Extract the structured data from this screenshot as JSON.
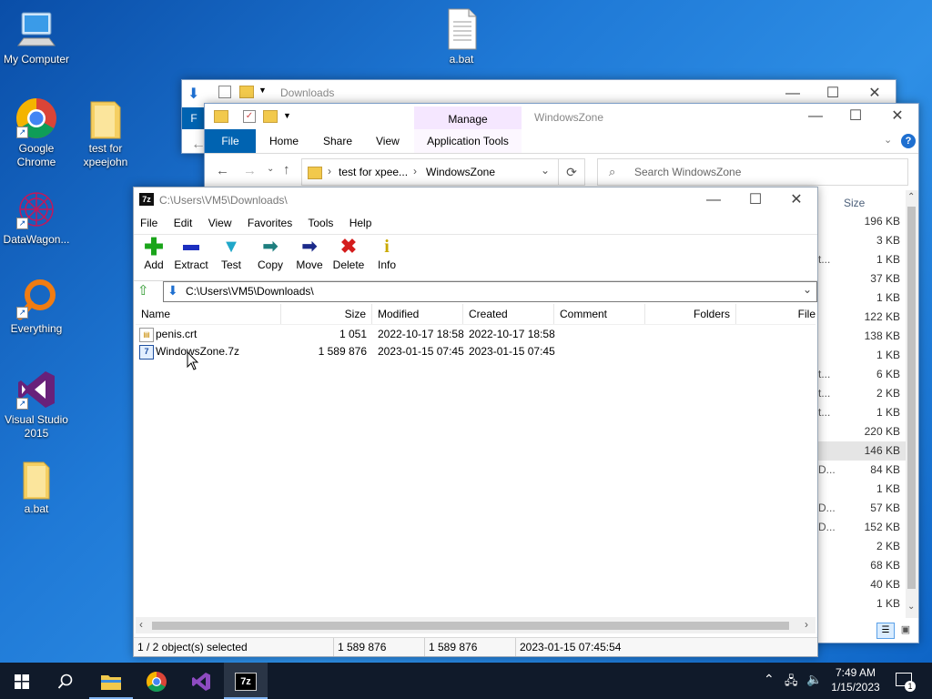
{
  "desktop": {
    "icons": [
      {
        "label": "My Computer"
      },
      {
        "label": "a.bat"
      },
      {
        "label": "Google Chrome"
      },
      {
        "label": "test for xpeejohn"
      },
      {
        "label": "DataWagon..."
      },
      {
        "label": "Everything"
      },
      {
        "label": "Visual Studio 2015"
      },
      {
        "label": "a.bat"
      }
    ]
  },
  "explorer_back": {
    "title": "Downloads",
    "file_tab": "F"
  },
  "explorer_front": {
    "title": "WindowsZone",
    "context_tab": "Manage",
    "tabs": [
      "File",
      "Home",
      "Share",
      "View",
      "Application Tools"
    ],
    "breadcrumb": [
      "test for xpee...",
      "WindowsZone"
    ],
    "search_placeholder": "Search WindowsZone",
    "size_header": "Size",
    "sizes": [
      "196 KB",
      "3 KB",
      "1 KB",
      "37 KB",
      "1 KB",
      "122 KB",
      "138 KB",
      "1 KB",
      "6 KB",
      "2 KB",
      "1 KB",
      "220 KB",
      "146 KB",
      "84 KB",
      "1 KB",
      "57 KB",
      "152 KB",
      "2 KB",
      "68 KB",
      "40 KB",
      "1 KB"
    ],
    "name_fragments": [
      "t...",
      "t...",
      "t...",
      "t...",
      "D...",
      "D...",
      "D..."
    ]
  },
  "sevenzip": {
    "title": "C:\\Users\\VM5\\Downloads\\",
    "app_icon": "7z",
    "menu": [
      "File",
      "Edit",
      "View",
      "Favorites",
      "Tools",
      "Help"
    ],
    "toolbar": [
      {
        "label": "Add",
        "icon": "plus-icon",
        "color": "#1aa51a"
      },
      {
        "label": "Extract",
        "icon": "minus-icon",
        "color": "#1c2fbf"
      },
      {
        "label": "Test",
        "icon": "check-icon",
        "color": "#20a7c9"
      },
      {
        "label": "Copy",
        "icon": "double-arrow-icon",
        "color": "#1e7f7f"
      },
      {
        "label": "Move",
        "icon": "arrow-icon",
        "color": "#1b2a8a"
      },
      {
        "label": "Delete",
        "icon": "x-icon",
        "color": "#d41c1c"
      },
      {
        "label": "Info",
        "icon": "info-icon",
        "color": "#c9a900"
      }
    ],
    "path": "C:\\Users\\VM5\\Downloads\\",
    "columns": [
      "Name",
      "Size",
      "Modified",
      "Created",
      "Comment",
      "Folders",
      "File"
    ],
    "files": [
      {
        "name": "penis.crt",
        "size": "1 051",
        "modified": "2022-10-17 18:58",
        "created": "2022-10-17 18:58"
      },
      {
        "name": "WindowsZone.7z",
        "size": "1 589 876",
        "modified": "2023-01-15 07:45",
        "created": "2023-01-15 07:45"
      }
    ],
    "status": {
      "selection": "1 / 2 object(s) selected",
      "size": "1 589 876",
      "packed": "1 589 876",
      "date": "2023-01-15 07:45:54"
    }
  },
  "taskbar": {
    "time": "7:49 AM",
    "date": "1/15/2023",
    "notification_count": "1",
    "seven_zip_label": "7z"
  },
  "colors": {
    "accent": "#0063b1",
    "manage_tab": "#f5e7ff",
    "taskbar": "#101a2a"
  }
}
